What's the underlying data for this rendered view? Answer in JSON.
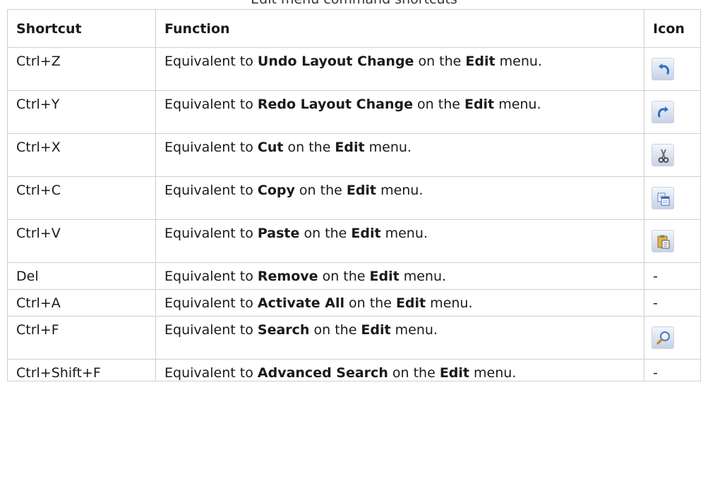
{
  "caption": "Edit menu command shortcuts",
  "table": {
    "headers": {
      "shortcut": "Shortcut",
      "function": "Function",
      "icon": "Icon"
    },
    "rows": [
      {
        "shortcut": "Ctrl+Z",
        "prefix": "Equivalent to ",
        "command": "Undo Layout Change",
        "middle": " on the ",
        "menu": "Edit",
        "suffix": " menu.",
        "icon": "undo-icon",
        "icon_text": ""
      },
      {
        "shortcut": "Ctrl+Y",
        "prefix": "Equivalent to ",
        "command": "Redo Layout Change",
        "middle": " on the ",
        "menu": "Edit",
        "suffix": " menu.",
        "icon": "redo-icon",
        "icon_text": ""
      },
      {
        "shortcut": "Ctrl+X",
        "prefix": "Equivalent to ",
        "command": "Cut",
        "middle": " on the ",
        "menu": "Edit",
        "suffix": " menu.",
        "icon": "cut-scissors-icon",
        "icon_text": ""
      },
      {
        "shortcut": "Ctrl+C",
        "prefix": "Equivalent to ",
        "command": "Copy",
        "middle": " on the ",
        "menu": "Edit",
        "suffix": " menu.",
        "icon": "copy-icon",
        "icon_text": ""
      },
      {
        "shortcut": "Ctrl+V",
        "prefix": "Equivalent to ",
        "command": "Paste",
        "middle": " on the ",
        "menu": "Edit",
        "suffix": " menu.",
        "icon": "paste-clipboard-icon",
        "icon_text": ""
      },
      {
        "shortcut": "Del",
        "prefix": "Equivalent to ",
        "command": "Remove",
        "middle": " on the ",
        "menu": "Edit",
        "suffix": " menu.",
        "icon": "none",
        "icon_text": "-"
      },
      {
        "shortcut": "Ctrl+A",
        "prefix": "Equivalent to ",
        "command": "Activate All",
        "middle": " on the ",
        "menu": "Edit",
        "suffix": " menu.",
        "icon": "none",
        "icon_text": "-"
      },
      {
        "shortcut": "Ctrl+F",
        "prefix": "Equivalent to ",
        "command": "Search",
        "middle": " on the ",
        "menu": "Edit",
        "suffix": " menu.",
        "icon": "search-magnifier-icon",
        "icon_text": ""
      },
      {
        "shortcut": "Ctrl+Shift+F",
        "prefix": "Equivalent to ",
        "command": "Advanced Search",
        "middle": " on the ",
        "menu": "Edit",
        "suffix": " menu.",
        "icon": "none",
        "icon_text": "-"
      }
    ]
  }
}
